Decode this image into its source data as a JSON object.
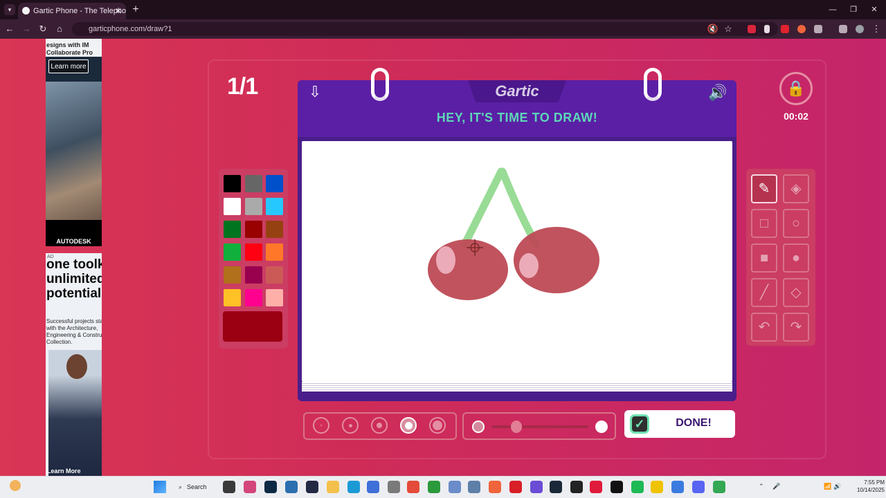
{
  "browser": {
    "tab_title": "Gartic Phone - The Telephone G",
    "url": "garticphone.com/draw?1",
    "close": "✕",
    "new_tab": "+"
  },
  "ads": {
    "ad1_top": "esigns with IM Collaborate Pro",
    "ad1_button": "Learn more",
    "ad1_brand": "AUTODESK",
    "ad2_headline": "one toolkit, unlimited potential",
    "ad2_sub": "Successful projects start with the Architecture, Engineering & Construction Collection.",
    "ad2_tag": "AD",
    "ad2_cta": "Learn More"
  },
  "game": {
    "counter": "1/1",
    "logo": "Gartic",
    "prompt": "HEY, IT'S TIME TO DRAW!",
    "timer": "00:02",
    "done_label": "DONE!",
    "current_color": "#9a0011",
    "palette": [
      "#000000",
      "#666666",
      "#0050cc",
      "#ffffff",
      "#aaaaaa",
      "#26c9ff",
      "#017420",
      "#990000",
      "#964112",
      "#11b03c",
      "#ff0013",
      "#ff7829",
      "#b0701c",
      "#99004e",
      "#cb5a57",
      "#ffc126",
      "#ff008f",
      "#feafa8"
    ],
    "tools": [
      "pencil-icon",
      "eraser-icon",
      "square-outline-icon",
      "circle-outline-icon",
      "square-filled-icon",
      "circle-filled-icon",
      "line-icon",
      "fill-bucket-icon",
      "undo-icon",
      "redo-icon"
    ],
    "selected_tool": "pencil-icon",
    "brush_sizes": 5,
    "selected_brush_size": 4,
    "opacity_level": 0.2
  },
  "taskbar": {
    "search": "Search",
    "time": "7:55 PM",
    "date": "10/14/2025"
  }
}
